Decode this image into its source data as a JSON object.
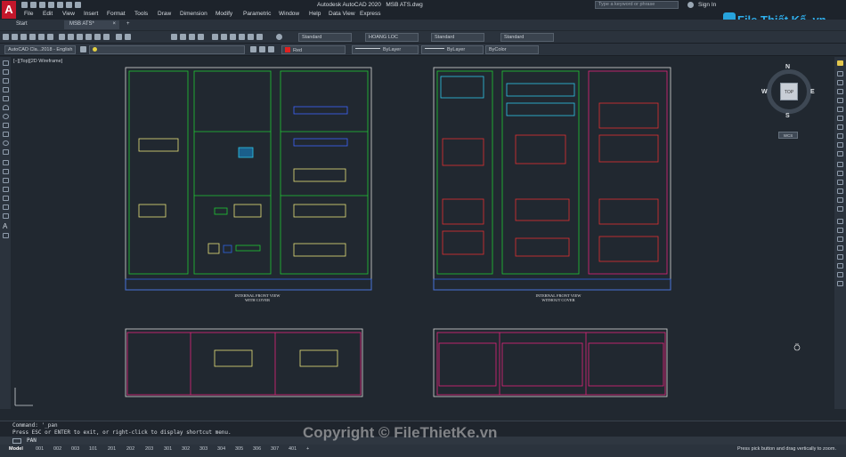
{
  "app_title": "Autodesk AutoCAD 2020",
  "file_title": "MSB ATS.dwg",
  "search_placeholder": "Type a keyword or phrase",
  "sign_in": "Sign In",
  "logo_text": "File Thiết Kế .vn",
  "menu": [
    "File",
    "Edit",
    "View",
    "Insert",
    "Format",
    "Tools",
    "Draw",
    "Dimension",
    "Modify",
    "Parametric",
    "Window",
    "Help",
    "Data View",
    "Express"
  ],
  "tabs": {
    "start": "Start",
    "doc": "MSB ATS*"
  },
  "toolbar": {
    "style1": "Standard",
    "layer_name": "HOANG LOC",
    "style2": "Standard",
    "style3": "Standard",
    "workspace": "AutoCAD Cla...2018 - English",
    "color": "Red",
    "linetype": "ByLayer",
    "lineweight": "ByLayer",
    "plotstyle": "ByColor"
  },
  "viewport_label": "[−][Top][2D Wireframe]",
  "viewcube": {
    "n": "N",
    "s": "S",
    "e": "E",
    "w": "W",
    "top": "TOP",
    "wcs": "WCS"
  },
  "drawing": {
    "label1a": "INTERNAL FRONT VIEW",
    "label1b": "WITH COVER",
    "label2a": "INTERNAL FRONT VIEW",
    "label2b": "WITHOUT COVER"
  },
  "command": {
    "line1": "Command: '_pan",
    "line2": "Press ESC or ENTER to exit, or right-click to display shortcut menu.",
    "prompt": "PAN"
  },
  "watermark": "Copyright © FileThietKe.vn",
  "layout_tabs": [
    "Model",
    "001",
    "002",
    "003",
    "101",
    "201",
    "202",
    "203",
    "301",
    "302",
    "303",
    "304",
    "305",
    "306",
    "307",
    "401"
  ],
  "status_text": "Press pick button and drag vertically to zoom."
}
